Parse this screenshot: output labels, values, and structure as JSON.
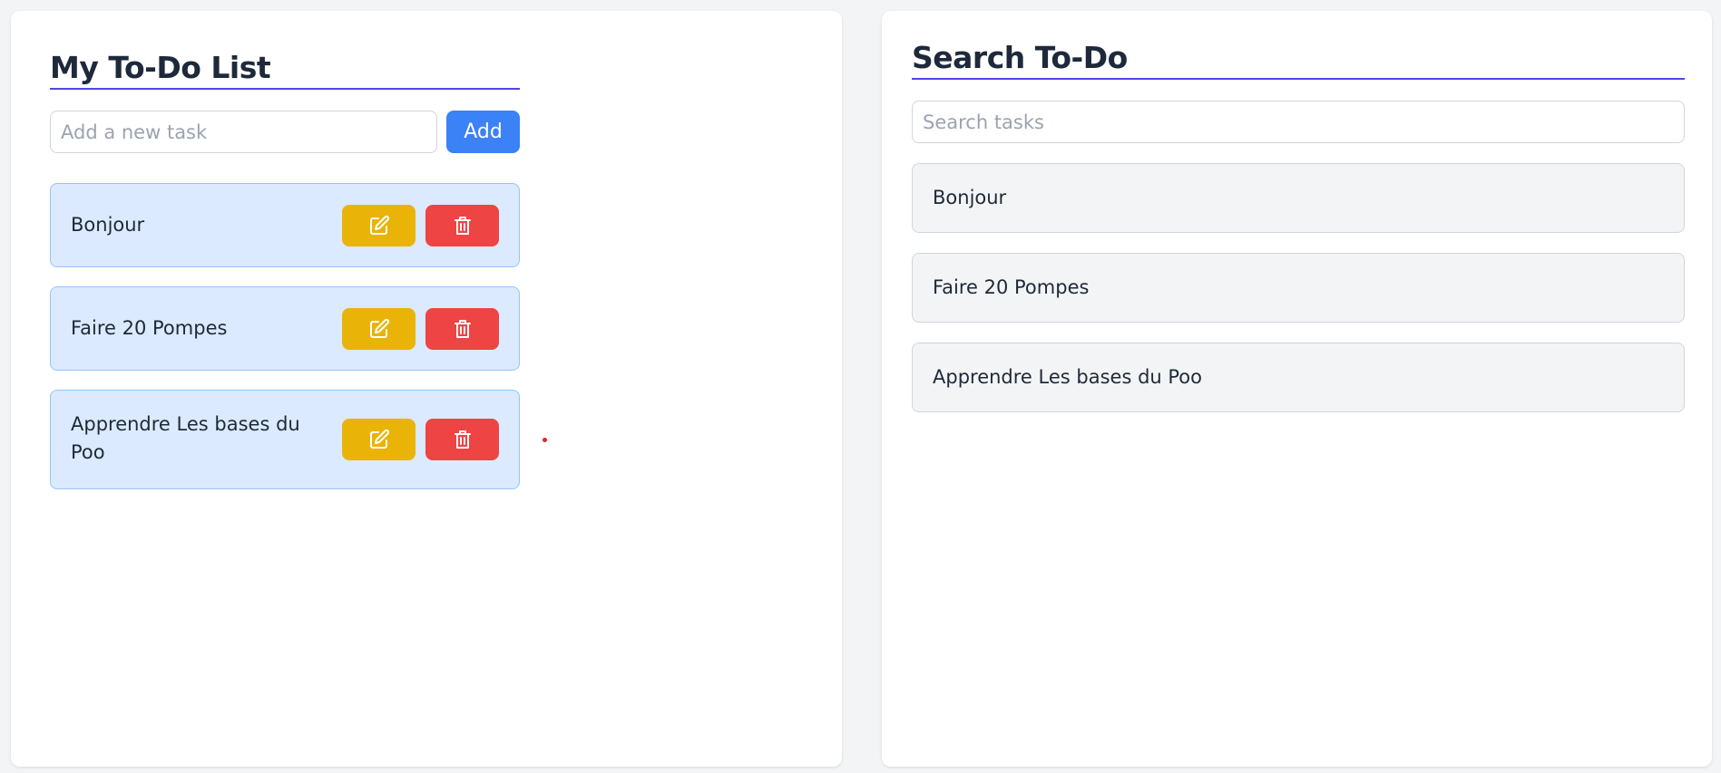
{
  "todo": {
    "title": "My To-Do List",
    "input": {
      "placeholder": "Add a new task",
      "value": ""
    },
    "add_label": "Add",
    "tasks": [
      {
        "label": "Bonjour"
      },
      {
        "label": "Faire 20 Pompes"
      },
      {
        "label": "Apprendre Les bases du Poo"
      }
    ],
    "edit_icon": "pencil-square-icon",
    "delete_icon": "trash-icon"
  },
  "search": {
    "title": "Search To-Do",
    "input": {
      "placeholder": "Search tasks",
      "value": ""
    },
    "results": [
      {
        "label": "Bonjour"
      },
      {
        "label": "Faire 20 Pompes"
      },
      {
        "label": "Apprendre Les bases du Poo"
      }
    ]
  },
  "colors": {
    "background": "#f3f4f6",
    "accent": "#4f46e5",
    "add_button": "#3b82f6",
    "edit_button": "#eab308",
    "delete_button": "#ef4444",
    "task_bg": "#dbeafe",
    "task_border": "#93c5fd"
  }
}
